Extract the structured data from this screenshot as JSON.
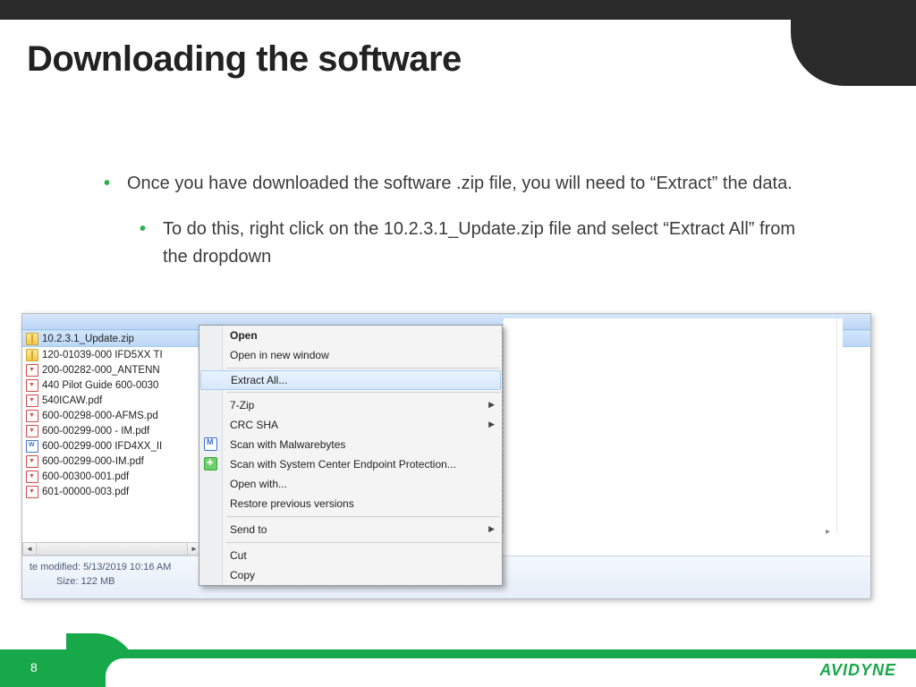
{
  "slide": {
    "title": "Downloading the software",
    "page_number": "8",
    "brand": "AVIDYNE"
  },
  "bullets": {
    "main": "Once you have downloaded the software .zip file, you will need to “Extract” the data.",
    "sub": "To do this, right click on the 10.2.3.1_Update.zip file and select “Extract All” from the dropdown"
  },
  "files": [
    {
      "name": "10.2.3.1_Update.zip",
      "type": "zip",
      "selected": true
    },
    {
      "name": "120-01039-000 IFD5XX TI",
      "type": "zip",
      "selected": false
    },
    {
      "name": "200-00282-000_ANTENN",
      "type": "pdf",
      "selected": false
    },
    {
      "name": "440 Pilot Guide 600-0030",
      "type": "pdf",
      "selected": false
    },
    {
      "name": "540ICAW.pdf",
      "type": "pdf",
      "selected": false
    },
    {
      "name": "600-00298-000-AFMS.pd",
      "type": "pdf",
      "selected": false
    },
    {
      "name": "600-00299-000 - IM.pdf",
      "type": "pdf",
      "selected": false
    },
    {
      "name": "600-00299-000 IFD4XX_II",
      "type": "doc",
      "selected": false
    },
    {
      "name": "600-00299-000-IM.pdf",
      "type": "pdf",
      "selected": false
    },
    {
      "name": "600-00300-001.pdf",
      "type": "pdf",
      "selected": false
    },
    {
      "name": "601-00000-003.pdf",
      "type": "pdf",
      "selected": false
    }
  ],
  "status": {
    "modified_label": "te modified:",
    "modified_value": "5/13/2019 10:16 AM",
    "size_label": "Size:",
    "size_value": "122 MB"
  },
  "context_menu": {
    "open": "Open",
    "open_new": "Open in new window",
    "extract_all": "Extract All...",
    "seven_zip": "7-Zip",
    "crc_sha": "CRC SHA",
    "malwarebytes": "Scan with Malwarebytes",
    "scep": "Scan with System Center Endpoint Protection...",
    "open_with": "Open with...",
    "restore": "Restore previous versions",
    "send_to": "Send to",
    "cut": "Cut",
    "copy": "Copy"
  }
}
